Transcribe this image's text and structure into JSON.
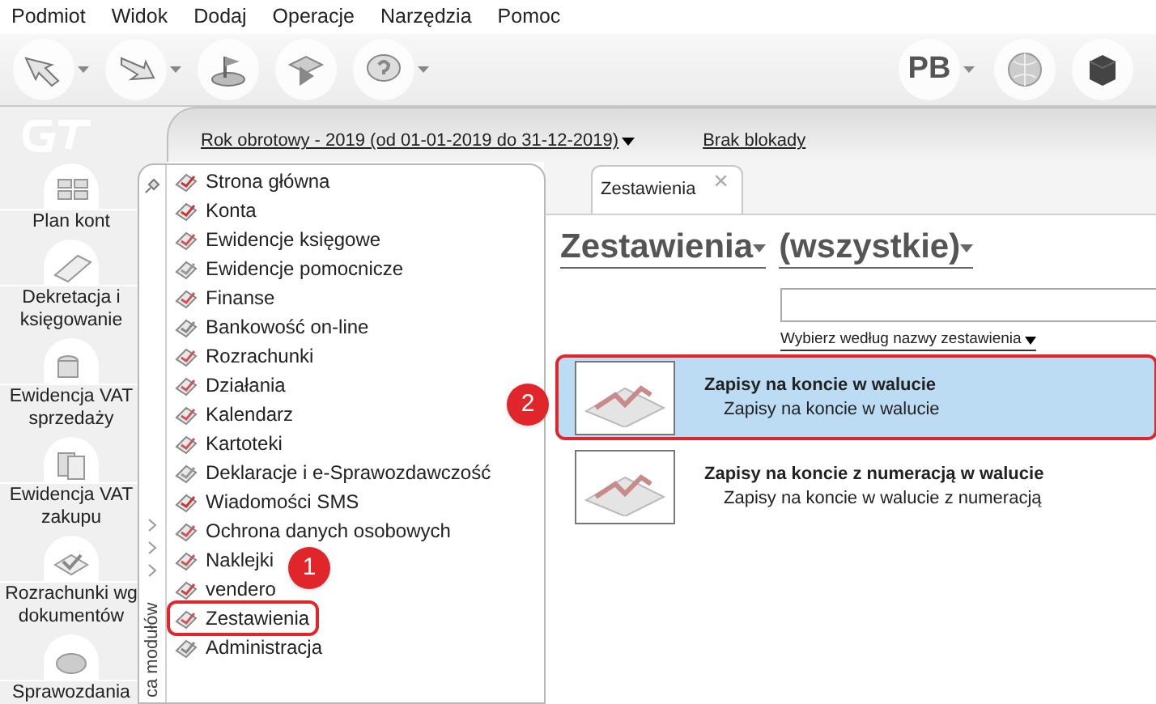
{
  "menu_bar": [
    "Podmiot",
    "Widok",
    "Dodaj",
    "Operacje",
    "Narzędzia",
    "Pomoc"
  ],
  "toolbar": {
    "user_button": "PB"
  },
  "header": {
    "fiscal_year": "Rok obrotowy - 2019  (od 01-01-2019 do 31-12-2019)",
    "lock_status": "Brak blokady"
  },
  "sidebar": {
    "items": [
      {
        "label": "Plan kont"
      },
      {
        "label": "Dekretacja i księgowanie"
      },
      {
        "label": "Ewidencja VAT sprzedaży"
      },
      {
        "label": "Ewidencja VAT zakupu"
      },
      {
        "label": "Rozrachunki wg dokumentów"
      },
      {
        "label": "Sprawozdania"
      }
    ]
  },
  "module_menu": {
    "side_label": "ca modułów",
    "items": [
      {
        "label": "Strona główna",
        "selected": false
      },
      {
        "label": "Konta",
        "selected": false
      },
      {
        "label": "Ewidencje księgowe",
        "selected": false
      },
      {
        "label": "Ewidencje pomocnicze",
        "selected": false
      },
      {
        "label": "Finanse",
        "selected": false
      },
      {
        "label": "Bankowość on-line",
        "selected": false
      },
      {
        "label": "Rozrachunki",
        "selected": false
      },
      {
        "label": "Działania",
        "selected": false
      },
      {
        "label": "Kalendarz",
        "selected": false
      },
      {
        "label": "Kartoteki",
        "selected": false
      },
      {
        "label": "Deklaracje i e-Sprawozdawczość",
        "selected": false
      },
      {
        "label": "Wiadomości SMS",
        "selected": false
      },
      {
        "label": "Ochrona danych osobowych",
        "selected": false
      },
      {
        "label": "Naklejki",
        "selected": false
      },
      {
        "label": "vendero",
        "selected": false
      },
      {
        "label": "Zestawienia",
        "selected": true
      },
      {
        "label": "Administracja",
        "selected": false
      }
    ]
  },
  "tabs": [
    {
      "label": "Zestawienia",
      "selected": true,
      "close": "×"
    }
  ],
  "content": {
    "category": "Zestawienia",
    "filter": "(wszystkie)",
    "sort_link": "Wybierz według nazwy zestawienia",
    "reports": [
      {
        "title": "Zapisy na koncie w walucie",
        "description": "Zapisy na koncie w walucie",
        "selected": true
      },
      {
        "title": "Zapisy na koncie z numeracją w walucie",
        "description": "Zapisy na koncie w walucie z numeracją",
        "selected": false
      }
    ]
  },
  "callouts": [
    {
      "number": "1"
    },
    {
      "number": "2"
    }
  ]
}
